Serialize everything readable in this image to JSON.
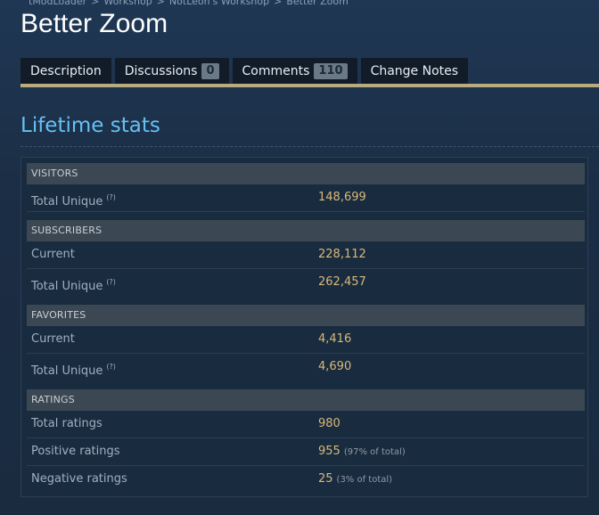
{
  "breadcrumb": [
    "tModLoader",
    "Workshop",
    "NotLeon's Workshop",
    "Better Zoom"
  ],
  "breadcrumb_sep": ">",
  "page_title": "Better Zoom",
  "tabs": [
    {
      "label": "Description",
      "count": null
    },
    {
      "label": "Discussions",
      "count": "0"
    },
    {
      "label": "Comments",
      "count": "110"
    },
    {
      "label": "Change Notes",
      "count": null
    }
  ],
  "section_title": "Lifetime stats",
  "help_marker": "(?)",
  "visitors": {
    "header": "VISITORS",
    "total_unique_label": "Total Unique",
    "total_unique_value": "148,699"
  },
  "subscribers": {
    "header": "SUBSCRIBERS",
    "current_label": "Current",
    "current_value": "228,112",
    "total_unique_label": "Total Unique",
    "total_unique_value": "262,457"
  },
  "favorites": {
    "header": "FAVORITES",
    "current_label": "Current",
    "current_value": "4,416",
    "total_unique_label": "Total Unique",
    "total_unique_value": "4,690"
  },
  "ratings": {
    "header": "RATINGS",
    "total_label": "Total ratings",
    "total_value": "980",
    "positive_label": "Positive ratings",
    "positive_value": "955",
    "positive_pct": "(97% of total)",
    "negative_label": "Negative ratings",
    "negative_value": "25",
    "negative_pct": "(3% of total)"
  },
  "colors": {
    "accent_blue": "#66c0f4",
    "value_gold": "#d9b97a",
    "tab_underline": "#b9ab7e"
  }
}
